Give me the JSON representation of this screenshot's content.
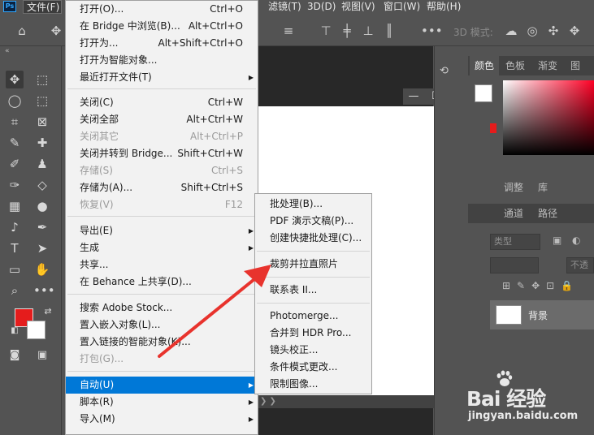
{
  "app": {
    "logo": "Ps"
  },
  "menubar": {
    "items": [
      "文件(F)",
      "滤镜(T)",
      "3D(D)",
      "视图(V)",
      "窗口(W)",
      "帮助(H)"
    ]
  },
  "options": {
    "mode_label": "3D 模式:"
  },
  "file_menu": {
    "items": [
      {
        "label": "打开(O)...",
        "shortcut": "Ctrl+O"
      },
      {
        "label": "在 Bridge 中浏览(B)...",
        "shortcut": "Alt+Ctrl+O"
      },
      {
        "label": "打开为...",
        "shortcut": "Alt+Shift+Ctrl+O"
      },
      {
        "label": "打开为智能对象...",
        "shortcut": ""
      },
      {
        "label": "最近打开文件(T)",
        "shortcut": ""
      },
      {
        "label": "关闭(C)",
        "shortcut": "Ctrl+W"
      },
      {
        "label": "关闭全部",
        "shortcut": "Alt+Ctrl+W"
      },
      {
        "label": "关闭其它",
        "shortcut": "Alt+Ctrl+P"
      },
      {
        "label": "关闭并转到 Bridge...",
        "shortcut": "Shift+Ctrl+W"
      },
      {
        "label": "存储(S)",
        "shortcut": "Ctrl+S"
      },
      {
        "label": "存储为(A)...",
        "shortcut": "Shift+Ctrl+S"
      },
      {
        "label": "恢复(V)",
        "shortcut": "F12"
      },
      {
        "label": "导出(E)",
        "shortcut": ""
      },
      {
        "label": "生成",
        "shortcut": ""
      },
      {
        "label": "共享...",
        "shortcut": ""
      },
      {
        "label": "在 Behance 上共享(D)...",
        "shortcut": ""
      },
      {
        "label": "搜索 Adobe Stock...",
        "shortcut": ""
      },
      {
        "label": "置入嵌入对象(L)...",
        "shortcut": ""
      },
      {
        "label": "置入链接的智能对象(K)...",
        "shortcut": ""
      },
      {
        "label": "打包(G)...",
        "shortcut": ""
      },
      {
        "label": "自动(U)",
        "shortcut": ""
      },
      {
        "label": "脚本(R)",
        "shortcut": ""
      },
      {
        "label": "导入(M)",
        "shortcut": ""
      }
    ]
  },
  "automate_submenu": {
    "items": [
      "批处理(B)...",
      "PDF 演示文稿(P)...",
      "创建快捷批处理(C)...",
      "裁剪并拉直照片",
      "联系表 II...",
      "Photomerge...",
      "合并到 HDR Pro...",
      "镜头校正...",
      "条件模式更改...",
      "限制图像..."
    ]
  },
  "panels": {
    "color_tabs": [
      "颜色",
      "色板",
      "渐变",
      "图案"
    ],
    "adjust_tabs": [
      "调整",
      "库"
    ],
    "layer_tabs": [
      "通道",
      "路径"
    ],
    "kind_select": "类型",
    "opacity_label": "不透",
    "layer_name": "背景"
  },
  "colors": {
    "foreground": "#e51c1c",
    "background": "#ffffff",
    "highlight": "#0078d7",
    "arrow": "#e8332d"
  },
  "watermark": {
    "logo": "Bai 经验",
    "url": "jingyan.baidu.com"
  }
}
